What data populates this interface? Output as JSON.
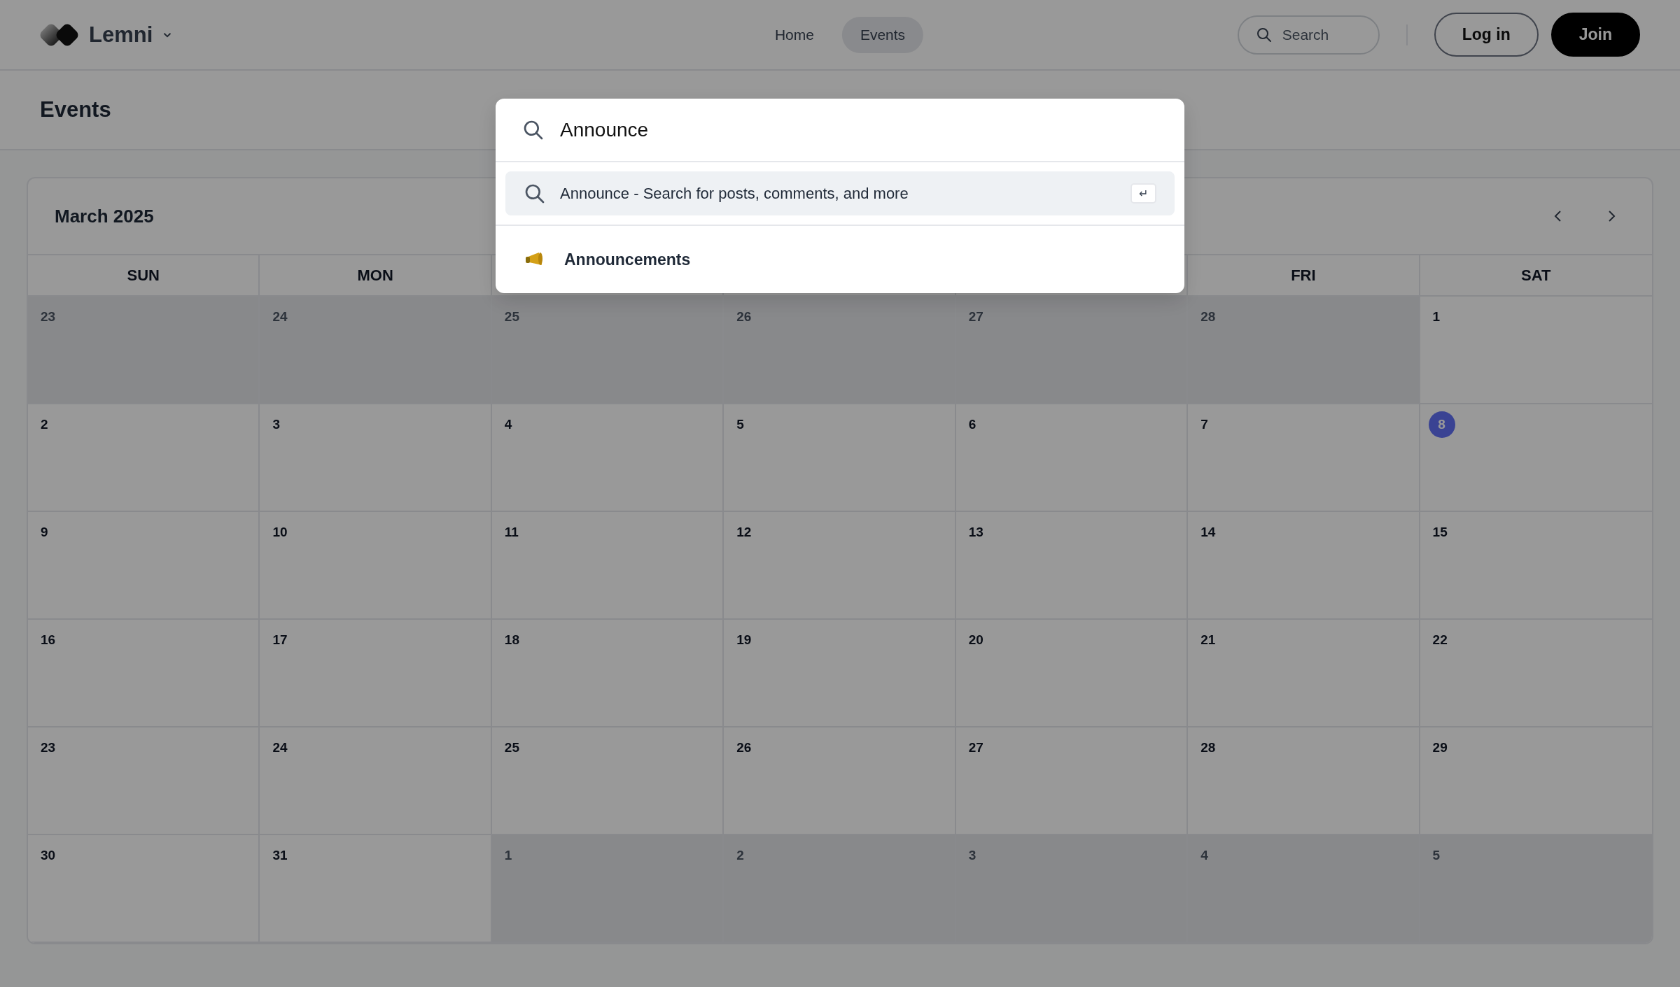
{
  "header": {
    "brand": "Lemni",
    "nav": [
      {
        "label": "Home",
        "selected": false
      },
      {
        "label": "Events",
        "selected": true
      }
    ],
    "search": {
      "placeholder": "Search"
    },
    "buttons": [
      {
        "label": "Log in",
        "kind": "outline"
      },
      {
        "label": "Join",
        "kind": "solid"
      }
    ]
  },
  "page_title": "Events",
  "calendar": {
    "month": "March 2025",
    "weekdays": {
      "column_1": "SUN",
      "column_2": "MON",
      "column_6": "FRI",
      "column_7": "SAT"
    },
    "weeks": [
      [
        {
          "day": "23",
          "in_month": false,
          "today": false
        },
        {
          "day": "24",
          "in_month": false,
          "today": false
        },
        {
          "day": "25",
          "in_month": false,
          "today": false
        },
        {
          "day": "26",
          "in_month": false,
          "today": false
        },
        {
          "day": "27",
          "in_month": false,
          "today": false
        },
        {
          "day": "28",
          "in_month": false,
          "today": false
        },
        {
          "day": "1",
          "in_month": true,
          "today": false
        }
      ],
      [
        {
          "day": "2",
          "in_month": true,
          "today": false
        },
        {
          "day": "3",
          "in_month": true,
          "today": false
        },
        {
          "day": "4",
          "in_month": true,
          "today": false
        },
        {
          "day": "5",
          "in_month": true,
          "today": false
        },
        {
          "day": "6",
          "in_month": true,
          "today": false
        },
        {
          "day": "7",
          "in_month": true,
          "today": false
        },
        {
          "day": "8",
          "in_month": true,
          "today": true
        }
      ],
      [
        {
          "day": "9",
          "in_month": true,
          "today": false
        },
        {
          "day": "10",
          "in_month": true,
          "today": false
        },
        {
          "day": "11",
          "in_month": true,
          "today": false
        },
        {
          "day": "12",
          "in_month": true,
          "today": false
        },
        {
          "day": "13",
          "in_month": true,
          "today": false
        },
        {
          "day": "14",
          "in_month": true,
          "today": false
        },
        {
          "day": "15",
          "in_month": true,
          "today": false
        }
      ],
      [
        {
          "day": "16",
          "in_month": true,
          "today": false
        },
        {
          "day": "17",
          "in_month": true,
          "today": false
        },
        {
          "day": "18",
          "in_month": true,
          "today": false
        },
        {
          "day": "19",
          "in_month": true,
          "today": false
        },
        {
          "day": "20",
          "in_month": true,
          "today": false
        },
        {
          "day": "21",
          "in_month": true,
          "today": false
        },
        {
          "day": "22",
          "in_month": true,
          "today": false
        }
      ],
      [
        {
          "day": "23",
          "in_month": true,
          "today": false
        },
        {
          "day": "24",
          "in_month": true,
          "today": false
        },
        {
          "day": "25",
          "in_month": true,
          "today": false
        },
        {
          "day": "26",
          "in_month": true,
          "today": false
        },
        {
          "day": "27",
          "in_month": true,
          "today": false
        },
        {
          "day": "28",
          "in_month": true,
          "today": false
        },
        {
          "day": "29",
          "in_month": true,
          "today": false
        }
      ],
      [
        {
          "day": "30",
          "in_month": true,
          "today": false
        },
        {
          "day": "31",
          "in_month": true,
          "today": false
        },
        {
          "day": "1",
          "in_month": false,
          "today": false
        },
        {
          "day": "2",
          "in_month": false,
          "today": false
        },
        {
          "day": "3",
          "in_month": false,
          "today": false
        },
        {
          "day": "4",
          "in_month": false,
          "today": false
        },
        {
          "day": "5",
          "in_month": false,
          "today": false
        }
      ]
    ]
  },
  "search_dialog": {
    "query": "Announce",
    "suggestion": {
      "text": "Announce - Search for posts, comments, and more",
      "key": "↵",
      "selected": true
    },
    "results": [
      {
        "label": "Announcements"
      }
    ]
  }
}
